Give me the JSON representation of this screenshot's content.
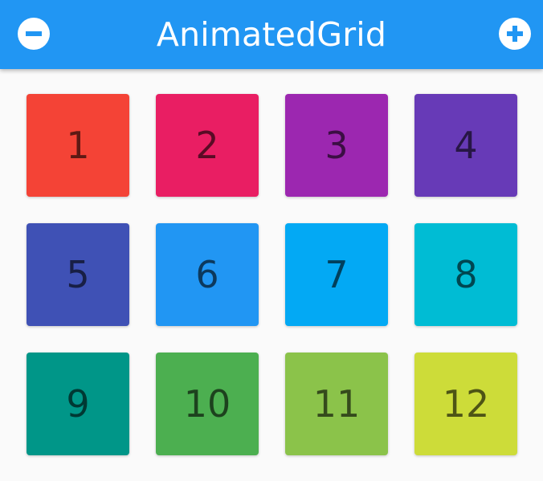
{
  "app_bar": {
    "title": "AnimatedGrid",
    "background": "#2196f3",
    "left_button_icon": "remove-circle-icon",
    "right_button_icon": "add-circle-icon"
  },
  "grid": {
    "items": [
      {
        "label": "1",
        "color": "#f44336"
      },
      {
        "label": "2",
        "color": "#e91e63"
      },
      {
        "label": "3",
        "color": "#9c27b0"
      },
      {
        "label": "4",
        "color": "#673ab7"
      },
      {
        "label": "5",
        "color": "#3f51b5"
      },
      {
        "label": "6",
        "color": "#2196f3"
      },
      {
        "label": "7",
        "color": "#03a9f4"
      },
      {
        "label": "8",
        "color": "#00bcd4"
      },
      {
        "label": "9",
        "color": "#009688"
      },
      {
        "label": "10",
        "color": "#4caf50"
      },
      {
        "label": "11",
        "color": "#8bc34a"
      },
      {
        "label": "12",
        "color": "#cddc39"
      }
    ]
  }
}
